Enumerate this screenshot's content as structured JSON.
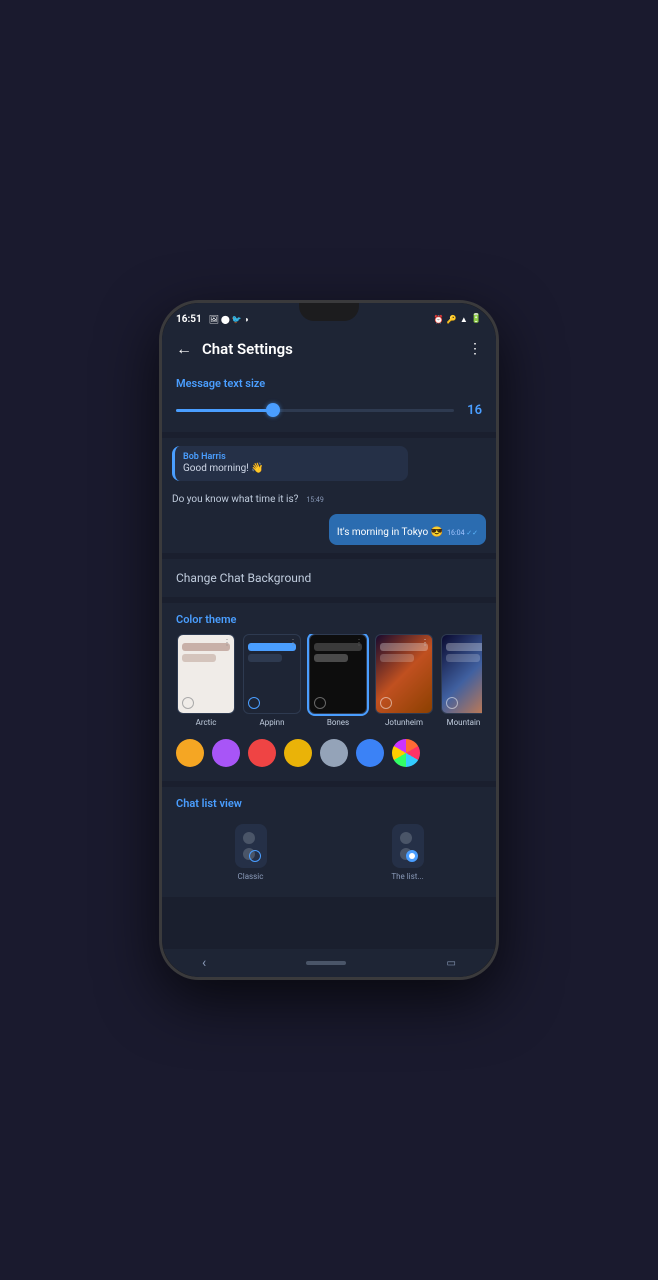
{
  "status_bar": {
    "time": "16:51",
    "right_icons": "⏰ ⌨ ▲ 🔋"
  },
  "app_bar": {
    "back_icon": "←",
    "title": "Chat Settings",
    "menu_icon": "⋮"
  },
  "message_text_size": {
    "label": "Message text size",
    "value": "16",
    "slider_percent": 35
  },
  "chat_preview": {
    "sender": "Bob Harris",
    "received_text1": "Good morning! 👋",
    "received_text2": "Do you know what time it is?",
    "received_time": "15:49",
    "sent_text": "It's morning in Tokyo 😎",
    "sent_time": "16:04",
    "sent_ticks": "✓✓"
  },
  "change_background": {
    "label": "Change Chat Background"
  },
  "color_theme": {
    "label": "Color theme",
    "themes": [
      {
        "id": "arctic",
        "name": "Arctic",
        "selected": false
      },
      {
        "id": "appinn",
        "name": "Appinn",
        "selected": false
      },
      {
        "id": "bones",
        "name": "Bones",
        "selected": false
      },
      {
        "id": "jotunheim",
        "name": "Jotunheim",
        "selected": false
      },
      {
        "id": "mountain",
        "name": "Mountain S...",
        "selected": false
      }
    ],
    "color_dots": [
      {
        "color": "#f5a623",
        "label": "orange"
      },
      {
        "color": "#a855f7",
        "label": "purple"
      },
      {
        "color": "#ef4444",
        "label": "red"
      },
      {
        "color": "#eab308",
        "label": "yellow"
      },
      {
        "color": "#94a3b8",
        "label": "gray"
      },
      {
        "color": "#3b82f6",
        "label": "blue"
      },
      {
        "color": "multi",
        "label": "multi"
      }
    ]
  },
  "chat_list_view": {
    "label": "Chat list view",
    "options": [
      {
        "id": "classic",
        "label": "Classic",
        "selected": false
      },
      {
        "id": "modern",
        "label": "The list...",
        "selected": true
      }
    ]
  },
  "bottom_nav": {
    "back": "‹",
    "home_pill": "",
    "recent": ""
  }
}
